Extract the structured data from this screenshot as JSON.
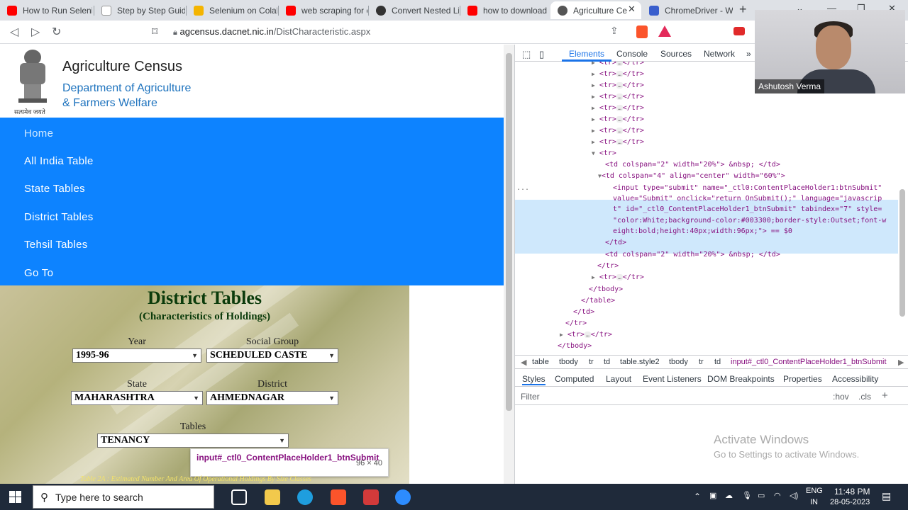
{
  "browser": {
    "tabs": [
      {
        "label": "How to Run Seleni",
        "color": "#ff0000"
      },
      {
        "label": "Step by Step Guide",
        "color": "#ffffff"
      },
      {
        "label": "Selenium on Colab",
        "color": "#f4b400"
      },
      {
        "label": "web scraping for c",
        "color": "#ff0000"
      },
      {
        "label": "Convert Nested Li",
        "color": "#333333"
      },
      {
        "label": "how to download",
        "color": "#ff0000"
      },
      {
        "label": "Agriculture Ce",
        "color": "#555555",
        "active": true
      },
      {
        "label": "ChromeDriver - W",
        "color": "#3a5fcd"
      }
    ],
    "close_glyph": "✕",
    "new_tab": "+",
    "url_host": "agcensus.dacnet.nic.in",
    "url_path": "/DistCharacteristic.aspx"
  },
  "site": {
    "title": "Agriculture Census",
    "dept_line1": "Department of Agriculture",
    "dept_line2": "& Farmers Welfare",
    "emblem_caption": "सत्यमेव जयते",
    "menu": [
      "Home",
      "All India Table",
      "State Tables",
      "District Tables",
      "Tehsil Tables",
      "Go To"
    ]
  },
  "form": {
    "heading": "District Tables",
    "subheading": "(Characteristics of Holdings)",
    "year_label": "Year",
    "year_value": "1995-96",
    "social_label": "Social Group",
    "social_value": "SCHEDULED CASTE",
    "state_label": "State",
    "state_value": "MAHARASHTRA",
    "district_label": "District",
    "district_value": "AHMEDNAGAR",
    "tables_label": "Tables",
    "tables_value": "TENANCY",
    "footnote": "Table 2A : Estimated Number And Area Of Operational Holdings By Size Classes"
  },
  "tooltip": {
    "name": "input#_ctl0_ContentPlaceHolder1_btnSubmit",
    "dims": "96 × 40"
  },
  "devtools": {
    "tabs": [
      "Elements",
      "Console",
      "Sources",
      "Network"
    ],
    "more": "»",
    "breadcrumbs": [
      "table",
      "tbody",
      "tr",
      "td",
      "table.style2",
      "tbody",
      "tr",
      "td",
      "input#_ctl0_ContentPlaceHolder1_btnSubmit"
    ],
    "subtabs": [
      "Styles",
      "Computed",
      "Layout",
      "Event Listeners",
      "DOM Breakpoints",
      "Properties",
      "Accessibility"
    ],
    "filter_placeholder": "Filter",
    "hov": ":hov",
    "cls": ".cls",
    "code": {
      "tr": "<tr>",
      "tr_close": "</tr>",
      "ellipsis": "…",
      "td1": "<td colspan=\"2\" width=\"20%\"> &nbsp; </td>",
      "td2": "<td colspan=\"4\" align=\"center\" width=\"60%\">",
      "input_l1": "<input type=\"submit\" name=\"_ctl0:ContentPlaceHolder1:btnSubmit\"",
      "input_l2": "value=\"Submit\" onclick=\"return OnSubmit();\" language=\"javascrip",
      "input_l3": "t\" id=\"_ctl0_ContentPlaceHolder1_btnSubmit\" tabindex=\"7\" style=",
      "input_l4": "\"color:White;background-color:#003300;border-style:Outset;font-w",
      "input_l5": "eight:bold;height:40px;width:96px;\"> == $0",
      "td_close": "</td>",
      "td3": "<td colspan=\"2\" width=\"20%\"> &nbsp; </td>",
      "tbody_close": "</tbody>",
      "table_close": "</table>",
      "dots": "..."
    },
    "watermark_title": "Activate Windows",
    "watermark_sub": "Go to Settings to activate Windows."
  },
  "webcam": {
    "name": "Ashutosh Verma"
  },
  "taskbar": {
    "search_placeholder": "Type here to search",
    "lang1": "ENG",
    "lang2": "IN",
    "time": "11:48 PM",
    "date": "28-05-2023"
  }
}
